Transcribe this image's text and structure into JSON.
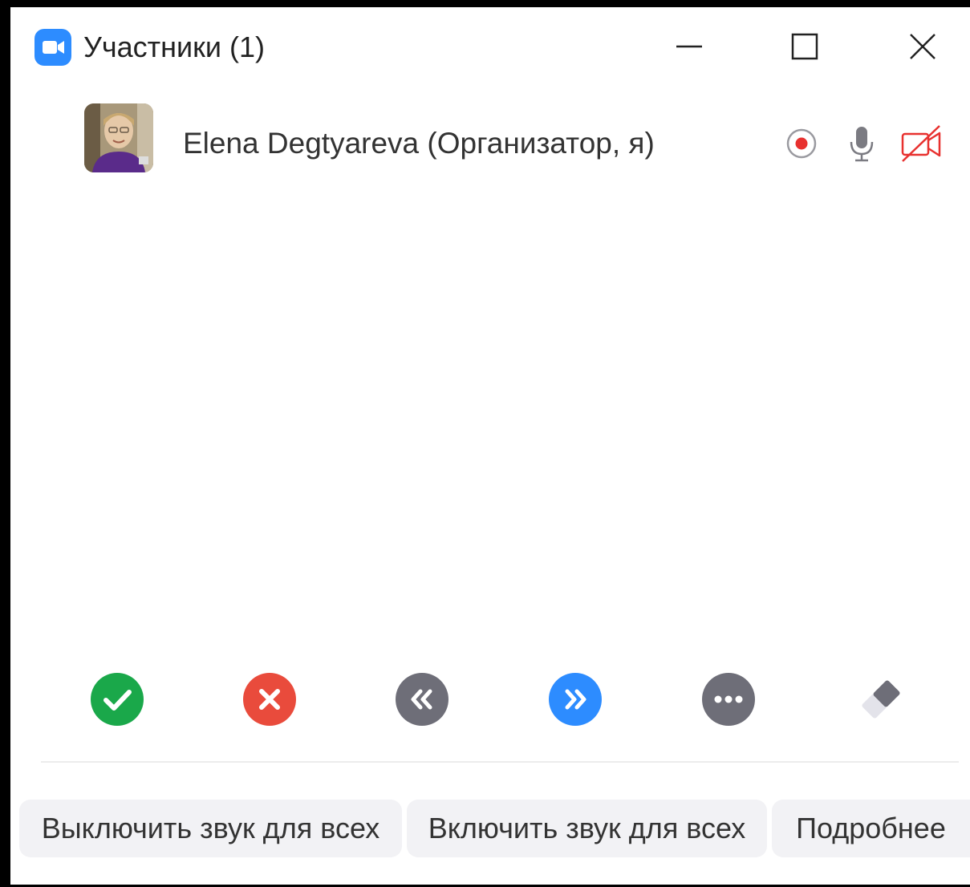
{
  "window": {
    "title": "Участники (1)",
    "logo_icon": "zoom-camera-icon",
    "controls": [
      "minimize-icon",
      "maximize-icon",
      "close-icon"
    ]
  },
  "participant": {
    "name": "Elena Degtyareva (Организатор, я)",
    "icons": [
      "recording-icon",
      "microphone-icon",
      "video-off-icon"
    ],
    "video_off_color": "#e8312f"
  },
  "reactions": [
    {
      "icon": "check-icon",
      "color": "#1aa84a"
    },
    {
      "icon": "cross-icon",
      "color": "#e94b3c"
    },
    {
      "icon": "slower-icon",
      "color": "#6e6e78"
    },
    {
      "icon": "faster-icon",
      "color": "#2d8cff"
    },
    {
      "icon": "more-icon",
      "color": "#6e6e78"
    },
    {
      "icon": "eraser-icon",
      "color": "#6e6e78"
    }
  ],
  "footer": {
    "mute_all_label": "Выключить звук для всех",
    "unmute_all_label": "Включить звук для всех",
    "more_label": "Подробнее"
  }
}
